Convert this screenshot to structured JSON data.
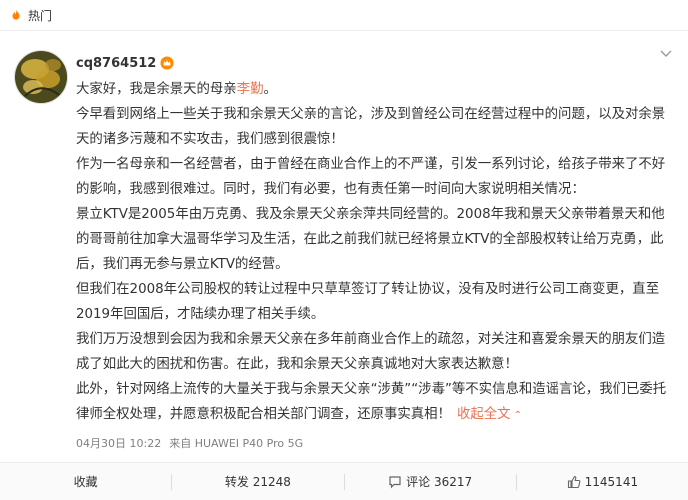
{
  "hot_bar": {
    "label": "热门",
    "icon": "flame-icon"
  },
  "post": {
    "username": "cq8764512",
    "badge_icon": "crown-badge-icon",
    "paragraphs": {
      "p1_before": "大家好，我是余景天的母亲",
      "p1_mention": "李勤",
      "p1_after": "。",
      "p2": "今早看到网络上一些关于我和余景天父亲的言论，涉及到曾经公司在经营过程中的问题，以及对余景天的诸多污蔑和不实攻击，我们感到很震惊！",
      "p3": "作为一名母亲和一名经营者，由于曾经在商业合作上的不严谨，引发一系列讨论，给孩子带来了不好的影响，我感到很难过。同时，我们有必要，也有责任第一时间向大家说明相关情况：",
      "p4": "景立KTV是2005年由万克勇、我及余景天父亲余萍共同经营的。2008年我和景天父亲带着景天和他的哥哥前往加拿大温哥华学习及生活，在此之前我们就已经将景立KTV的全部股权转让给万克勇，此后，我们再无参与景立KTV的经营。",
      "p5": "但我们在2008年公司股权的转让过程中只草草签订了转让协议，没有及时进行公司工商变更，直至2019年回国后，才陆续办理了相关手续。",
      "p6": "我们万万没想到会因为我和余景天父亲在多年前商业合作上的疏忽，对关注和喜爱余景天的朋友们造成了如此大的困扰和伤害。在此，我和余景天父亲真诚地对大家表达歉意！",
      "p7": "此外，针对网络上流传的大量关于我与余景天父亲“涉黄”“涉毒”等不实信息和造谣言论，我们已委托律师全权处理，并愿意积极配合相关部门调查，还原事实真相！"
    },
    "expand_label": "收起全文",
    "timestamp": "04月30日 10:22",
    "source": "来自 HUAWEI P40 Pro 5G"
  },
  "actions": {
    "favorite": "收藏",
    "repost": "转发 21248",
    "comment": "评论 36217",
    "like": "1145141"
  },
  "colors": {
    "accent": "#eb7350",
    "text": "#333333",
    "meta": "#808080"
  }
}
